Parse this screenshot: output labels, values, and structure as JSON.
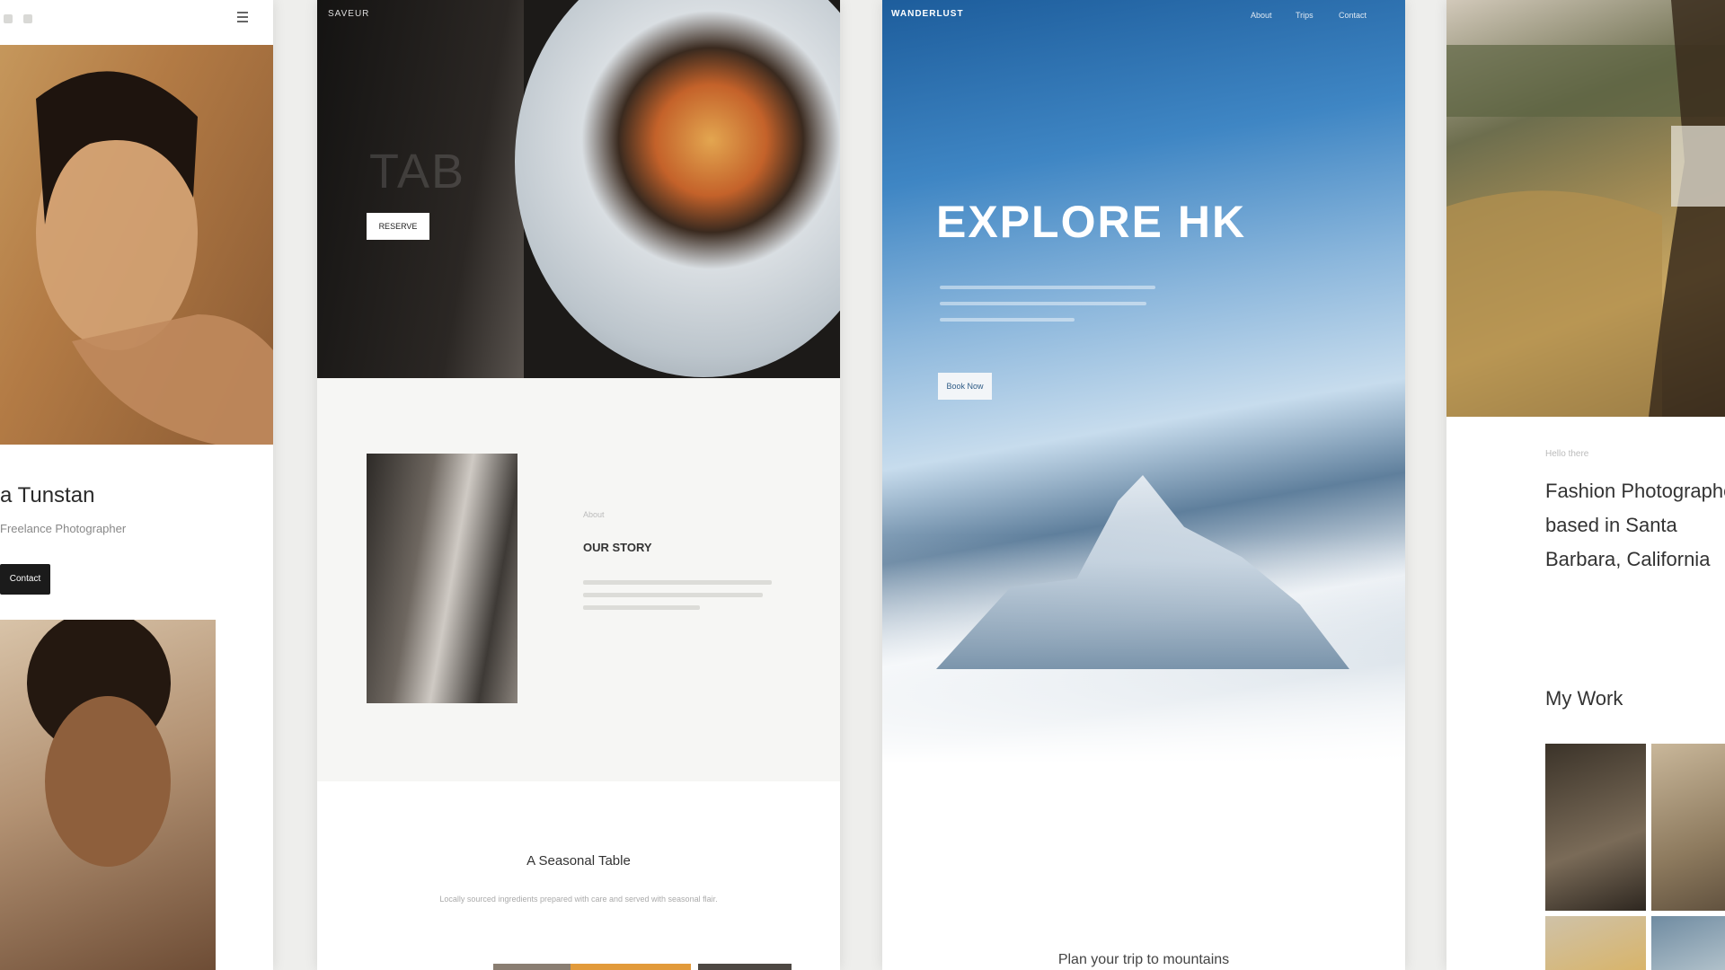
{
  "card1": {
    "name": "a Tunstan",
    "subtitle": "Freelance Photographer",
    "button_label": "Contact"
  },
  "card2": {
    "logo": "SAVEUR",
    "hero_word": "TAB",
    "cta_label": "RESERVE",
    "eyebrow": "About",
    "about_heading": "OUR STORY",
    "section_title": "A Seasonal Table",
    "section_desc": "Locally sourced ingredients prepared with care and served with seasonal flair."
  },
  "card3": {
    "logo": "WANDERLUST",
    "nav": [
      "About",
      "Trips",
      "Contact"
    ],
    "hero_title": "EXPLORE HK",
    "button_label": "Book Now",
    "footer_text": "Plan your trip to mountains"
  },
  "card4": {
    "eyebrow": "Hello there",
    "headline": "Fashion Photographer based in Santa Barbara, California",
    "my_work": "My Work"
  }
}
